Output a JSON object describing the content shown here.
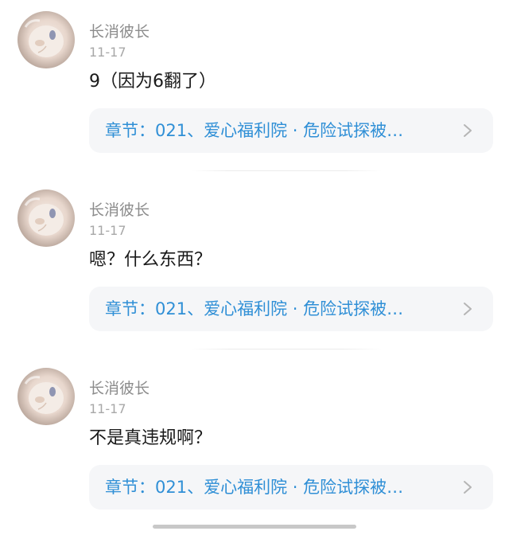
{
  "comments": [
    {
      "username": "长消彼长",
      "date": "11-17",
      "content": "9（因为6翻了）",
      "chapter_link": "章节：021、爱心福利院 · 危险试探被…"
    },
    {
      "username": "长消彼长",
      "date": "11-17",
      "content": "嗯？什么东西？",
      "chapter_link": "章节：021、爱心福利院 · 危险试探被…"
    },
    {
      "username": "长消彼长",
      "date": "11-17",
      "content": "不是真违规啊？",
      "chapter_link": "章节：021、爱心福利院 · 危险试探被…"
    }
  ],
  "colors": {
    "link": "#2f8fd6",
    "link_bg": "#f5f6f8",
    "username": "#8c8c8c",
    "date": "#a8a8a8",
    "content": "#1a1a1a"
  },
  "icons": {
    "avatar": "white-cat-avatar",
    "chevron": "chevron-right-icon"
  }
}
